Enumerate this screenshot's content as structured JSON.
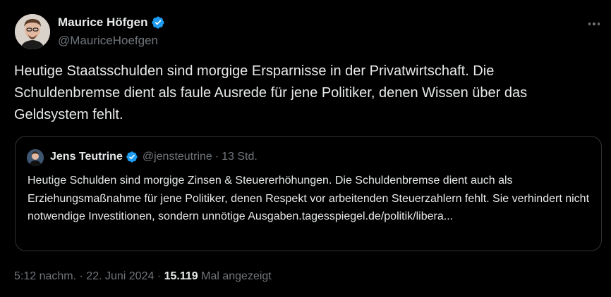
{
  "author": {
    "name": "Maurice Höfgen",
    "handle": "@MauriceHoefgen"
  },
  "tweet": {
    "text": "Heutige Staatsschulden sind morgige Ersparnisse in der Privatwirtschaft. Die Schuldenbremse dient als faule Ausrede für jene Politiker, denen Wissen über das Geldsystem fehlt."
  },
  "quote": {
    "name": "Jens Teutrine",
    "handle": "@jensteutrine",
    "separator": "·",
    "time": "13 Std.",
    "text": "Heutige Schulden sind morgige Zinsen & Steuererhöhungen. Die Schuldenbremse dient auch als Erziehungsmaßnahme für jene Politiker, denen Respekt vor arbeitenden Steuerzahlern fehlt. Sie verhindert nicht notwendige Investitionen, sondern unnötige Ausgaben.tagesspiegel.de/politik/libera..."
  },
  "meta": {
    "time": "5:12 nachm.",
    "sep1": "·",
    "date": "22. Juni 2024",
    "sep2": "·",
    "views": "15.119",
    "views_label": "Mal angezeigt"
  },
  "icons": {
    "verified": "verified-badge-icon",
    "more": "more-options-icon"
  },
  "colors": {
    "background": "#000000",
    "text": "#e7e9ea",
    "muted": "#71767b",
    "verified": "#1d9bf0",
    "border": "#2f3336"
  }
}
